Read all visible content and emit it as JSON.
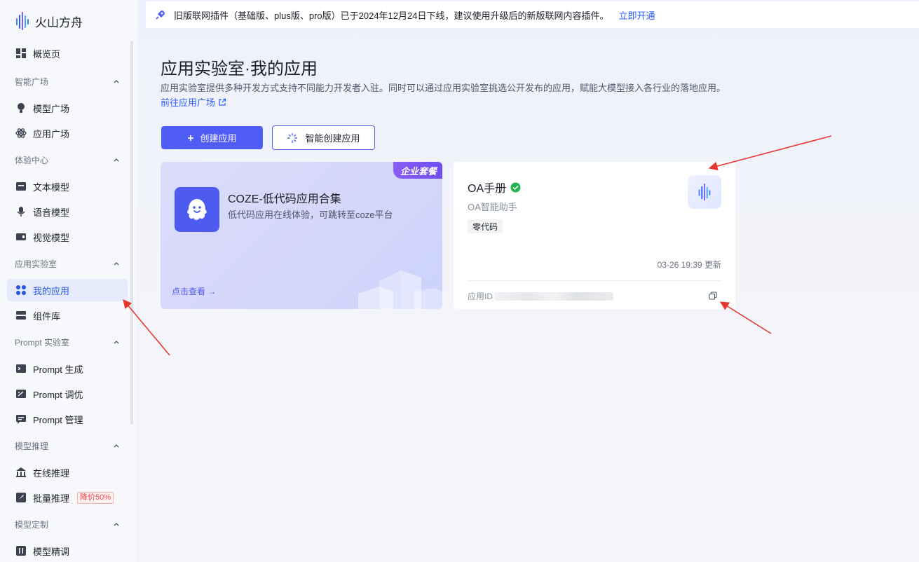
{
  "brand": {
    "name": "火山方舟"
  },
  "sidebar": {
    "overview": "概览页",
    "groups": [
      {
        "title": "智能广场",
        "items": [
          "模型广场",
          "应用广场"
        ]
      },
      {
        "title": "体验中心",
        "items": [
          "文本模型",
          "语音模型",
          "视觉模型"
        ]
      },
      {
        "title": "应用实验室",
        "items": [
          "我的应用",
          "组件库"
        ]
      },
      {
        "title": "Prompt 实验室",
        "items": [
          "Prompt 生成",
          "Prompt 调优",
          "Prompt 管理"
        ]
      },
      {
        "title": "模型推理",
        "items": [
          "在线推理",
          "批量推理"
        ]
      },
      {
        "title": "模型定制",
        "items": [
          "模型精调"
        ]
      }
    ],
    "active_item": "我的应用",
    "discount_badge": "降价50%"
  },
  "notice": {
    "text": "旧版联网插件（基础版、plus版、pro版）已于2024年12月24日下线，建议使用升级后的新版联网内容插件。",
    "link": "立即开通"
  },
  "page": {
    "title": "应用实验室·我的应用",
    "description": "应用实验室提供多种开发方式支持不同能力开发者入驻。同时可以通过应用实验室挑选公开发布的应用，赋能大模型接入各行业的落地应用。",
    "goto_link": "前往应用广场"
  },
  "actions": {
    "create": "创建应用",
    "smart_create": "智能创建应用"
  },
  "coze_card": {
    "corner_tag": "企业套餐",
    "title": "COZE-低代码应用合集",
    "description": "低代码应用在线体验，可跳转至coze平台",
    "view": "点击查看 →"
  },
  "app_card": {
    "name": "OA手册",
    "subtitle": "OA智能助手",
    "tag": "零代码",
    "updated": "03-26 19:39 更新",
    "id_label": "应用ID"
  },
  "colors": {
    "primary": "#4f5cf5",
    "link": "#2d5bff",
    "active_bg": "#e6ecfb",
    "success": "#22b14c",
    "arrow": "#e8352e"
  }
}
